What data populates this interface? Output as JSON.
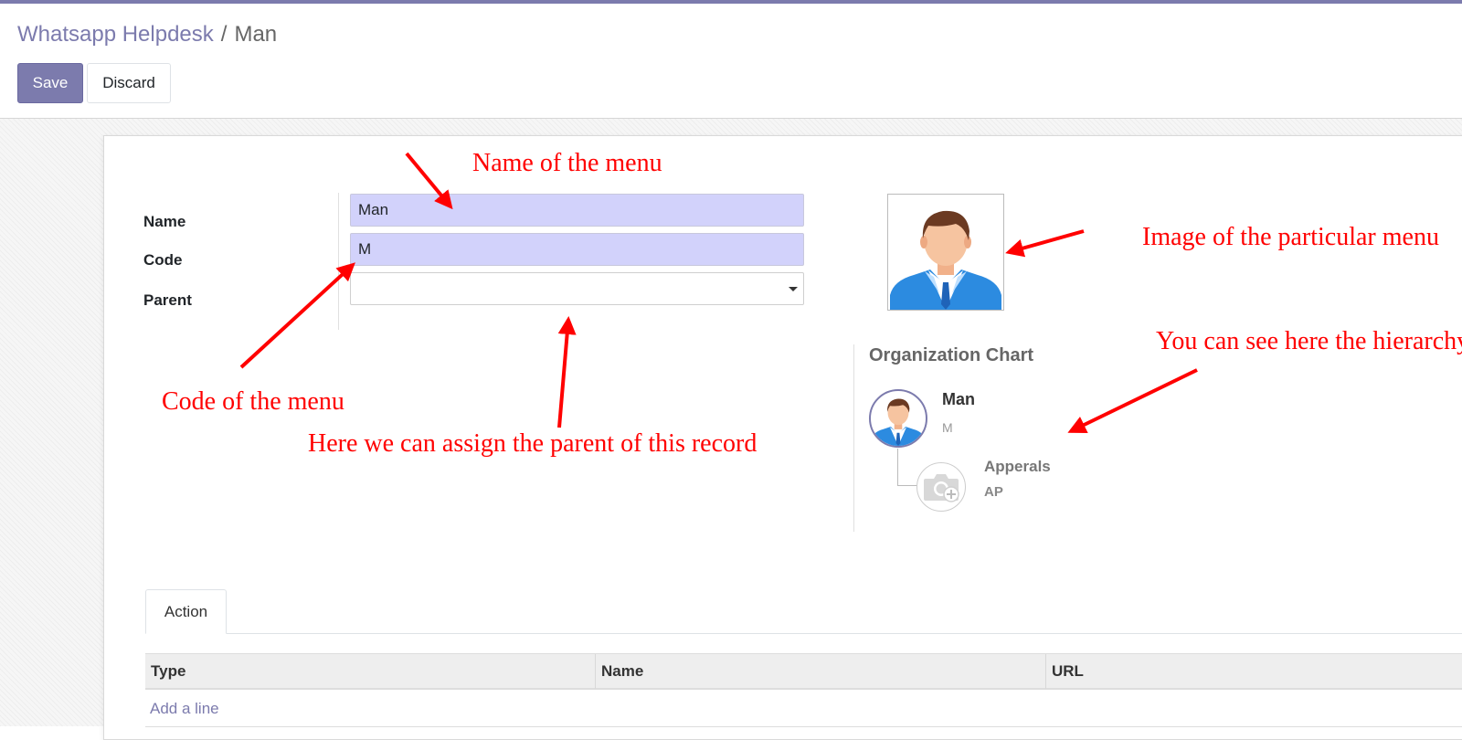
{
  "breadcrumb": {
    "parent": "Whatsapp Helpdesk",
    "separator": "/",
    "current": "Man"
  },
  "buttons": {
    "save": "Save",
    "discard": "Discard"
  },
  "form": {
    "name_label": "Name",
    "name_value": "Man",
    "code_label": "Code",
    "code_value": "M",
    "parent_label": "Parent",
    "parent_value": ""
  },
  "org_chart": {
    "title": "Organization Chart",
    "current": {
      "name": "Man",
      "code": "M"
    },
    "child": {
      "name": "Apperals",
      "code": "AP"
    }
  },
  "tabs": [
    {
      "label": "Action"
    }
  ],
  "table": {
    "columns": [
      "Type",
      "Name",
      "URL"
    ],
    "add_line": "Add a line"
  },
  "annotations": {
    "name": "Name of the menu",
    "code": "Code of the menu",
    "parent": "Here we can assign the parent of this record",
    "image": "Image of the particular menu",
    "hierarchy": "You can see here the hierarchy"
  },
  "colors": {
    "primary": "#7c7bad",
    "field_highlight": "#d2d2fb",
    "annotation": "#ff0000"
  },
  "icons": {
    "dropdown": "caret-down-icon",
    "photo": "man-avatar-icon",
    "placeholder": "camera-plus-icon"
  }
}
